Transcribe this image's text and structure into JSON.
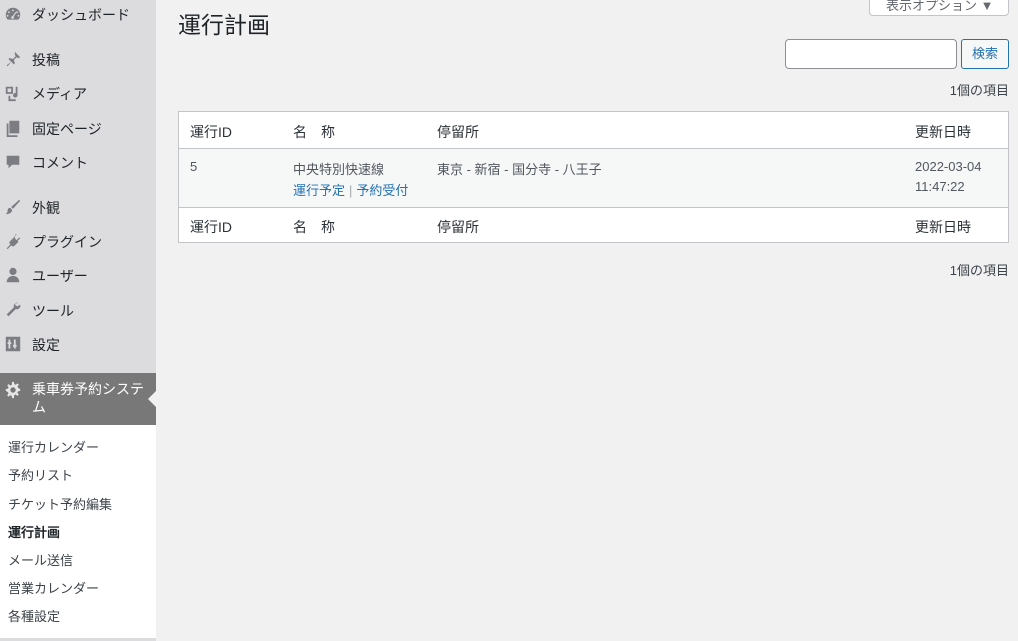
{
  "sidebar": {
    "items": [
      {
        "label": "ダッシュボード",
        "icon": "dashboard-icon"
      },
      {
        "label": "投稿",
        "icon": "pin-icon"
      },
      {
        "label": "メディア",
        "icon": "media-icon"
      },
      {
        "label": "固定ページ",
        "icon": "page-icon"
      },
      {
        "label": "コメント",
        "icon": "comment-icon"
      },
      {
        "label": "外観",
        "icon": "brush-icon"
      },
      {
        "label": "プラグイン",
        "icon": "plugin-icon"
      },
      {
        "label": "ユーザー",
        "icon": "user-icon"
      },
      {
        "label": "ツール",
        "icon": "wrench-icon"
      },
      {
        "label": "設定",
        "icon": "settings-icon"
      }
    ],
    "current": {
      "label": "乗車券予約システム",
      "icon": "gear-icon"
    },
    "submenu": [
      {
        "label": "運行カレンダー"
      },
      {
        "label": "予約リスト"
      },
      {
        "label": "チケット予約編集"
      },
      {
        "label": "運行計画"
      },
      {
        "label": "メール送信"
      },
      {
        "label": "営業カレンダー"
      },
      {
        "label": "各種設定"
      }
    ]
  },
  "header": {
    "title": "運行計画",
    "screen_options": "表示オプション ▼"
  },
  "search": {
    "value": "",
    "button_label": "検索"
  },
  "item_count_top": "1個の項目",
  "item_count_bottom": "1個の項目",
  "table": {
    "columns": [
      "運行ID",
      "名　称",
      "停留所",
      "更新日時"
    ],
    "rows": [
      {
        "id": "5",
        "name": "中央特別快速線",
        "actions": [
          "運行予定",
          "予約受付"
        ],
        "action_separator": "|",
        "stops": "東京 - 新宿 - 国分寺 - 八王子",
        "updated_date": "2022-03-04",
        "updated_time": "11:47:22"
      }
    ]
  },
  "colors": {
    "sidebar_bg": "#dcdcde",
    "current_menu_bg": "#787878",
    "link": "#2271b1"
  }
}
